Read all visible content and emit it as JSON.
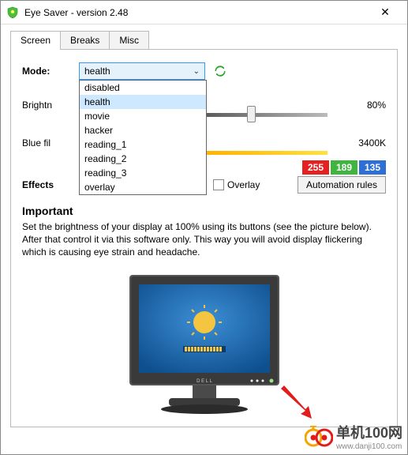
{
  "window": {
    "title": "Eye Saver - version 2.48",
    "icon": "shield-icon"
  },
  "tabs": [
    {
      "label": "Screen",
      "active": true
    },
    {
      "label": "Breaks",
      "active": false
    },
    {
      "label": "Misc",
      "active": false
    }
  ],
  "mode": {
    "label": "Mode:",
    "selected": "health",
    "options": [
      "disabled",
      "health",
      "movie",
      "hacker",
      "reading_1",
      "reading_2",
      "reading_3",
      "overlay"
    ],
    "highlighted": "health"
  },
  "brightness": {
    "label": "Brightn",
    "value_text": "80%"
  },
  "bluefilter": {
    "label": "Blue fil",
    "value_text": "3400K"
  },
  "rgb": {
    "r": "255",
    "g": "189",
    "b": "135"
  },
  "effects": {
    "label": "Effects",
    "overlay_label": "Overlay"
  },
  "automation_button": "Automation rules",
  "important": {
    "heading": "Important",
    "text": "Set the brightness of your display at 100% using its buttons (see the picture below). After that control it via this software only. This way you will avoid display flickering which is causing eye strain and headache."
  },
  "watermark": {
    "big": "单机100网",
    "small": "www.danji100.com"
  }
}
